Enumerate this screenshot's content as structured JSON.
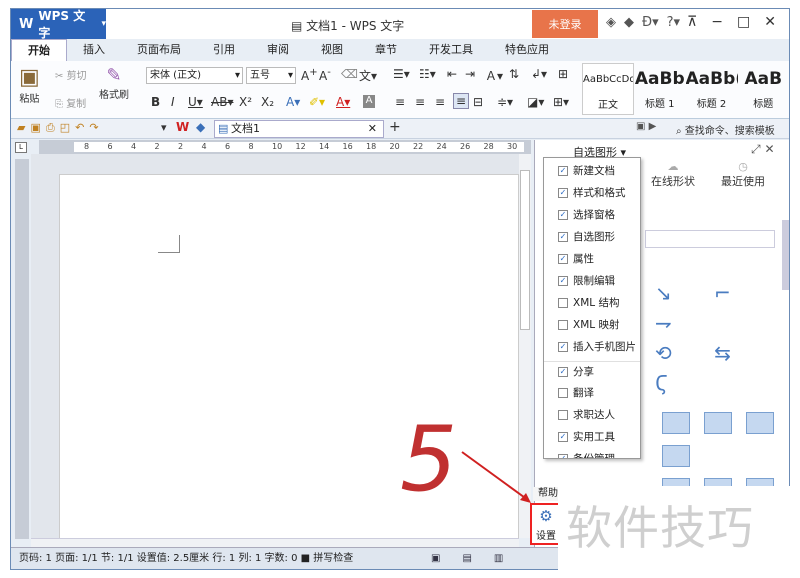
{
  "app": {
    "logo_text": "WPS 文字",
    "window_title": "文档1 - WPS 文字",
    "login_label": "未登录"
  },
  "tabs": [
    {
      "label": "开始",
      "active": true
    },
    {
      "label": "插入"
    },
    {
      "label": "页面布局"
    },
    {
      "label": "引用"
    },
    {
      "label": "审阅"
    },
    {
      "label": "视图"
    },
    {
      "label": "章节"
    },
    {
      "label": "开发工具"
    },
    {
      "label": "特色应用"
    }
  ],
  "ribbon": {
    "paste_label": "粘贴",
    "cut_label": "剪切",
    "copy_label": "复制",
    "format_painter_label": "格式刷",
    "font_name": "宋体 (正文)",
    "font_size": "五号",
    "styles": [
      {
        "preview": "AaBbCcDd",
        "label": "正文"
      },
      {
        "preview": "AaBb",
        "label": "标题 1"
      },
      {
        "preview": "AaBb(",
        "label": "标题 2"
      },
      {
        "preview": "AaB",
        "label": "标题"
      }
    ]
  },
  "qat": {
    "doc_tab": "文档1",
    "search_placeholder": "查找命令、搜索模板"
  },
  "ruler": {
    "h_ticks": [
      "8",
      "6",
      "4",
      "2",
      "2",
      "4",
      "6",
      "8",
      "10",
      "12",
      "14",
      "16",
      "18",
      "20",
      "22",
      "24",
      "26",
      "28",
      "30"
    ]
  },
  "taskpane": {
    "title": "自选图形",
    "tab_online": "在线形状",
    "tab_recent": "最近使用"
  },
  "menu": {
    "items": [
      {
        "label": "新建文档",
        "checked": true
      },
      {
        "label": "样式和格式",
        "checked": true
      },
      {
        "label": "选择窗格",
        "checked": true
      },
      {
        "label": "自选图形",
        "checked": true
      },
      {
        "label": "属性",
        "checked": true
      },
      {
        "label": "限制编辑",
        "checked": true
      },
      {
        "label": "XML 结构",
        "checked": false
      },
      {
        "label": "XML 映射",
        "checked": false
      },
      {
        "label": "插入手机图片",
        "checked": true
      },
      {
        "label": "分享",
        "checked": true
      },
      {
        "label": "翻译",
        "checked": false
      },
      {
        "label": "求职达人",
        "checked": false
      },
      {
        "label": "实用工具",
        "checked": true
      },
      {
        "label": "备份管理",
        "checked": true
      }
    ]
  },
  "help_label": "帮助",
  "settings_label": "设置",
  "watermark": "软件技巧",
  "annotation_number": "5",
  "status": {
    "text": "页码: 1  页面: 1/1  节: 1/1  设置值: 2.5厘米  行: 1  列: 1  字数: 0  ■ 拼写检查"
  }
}
